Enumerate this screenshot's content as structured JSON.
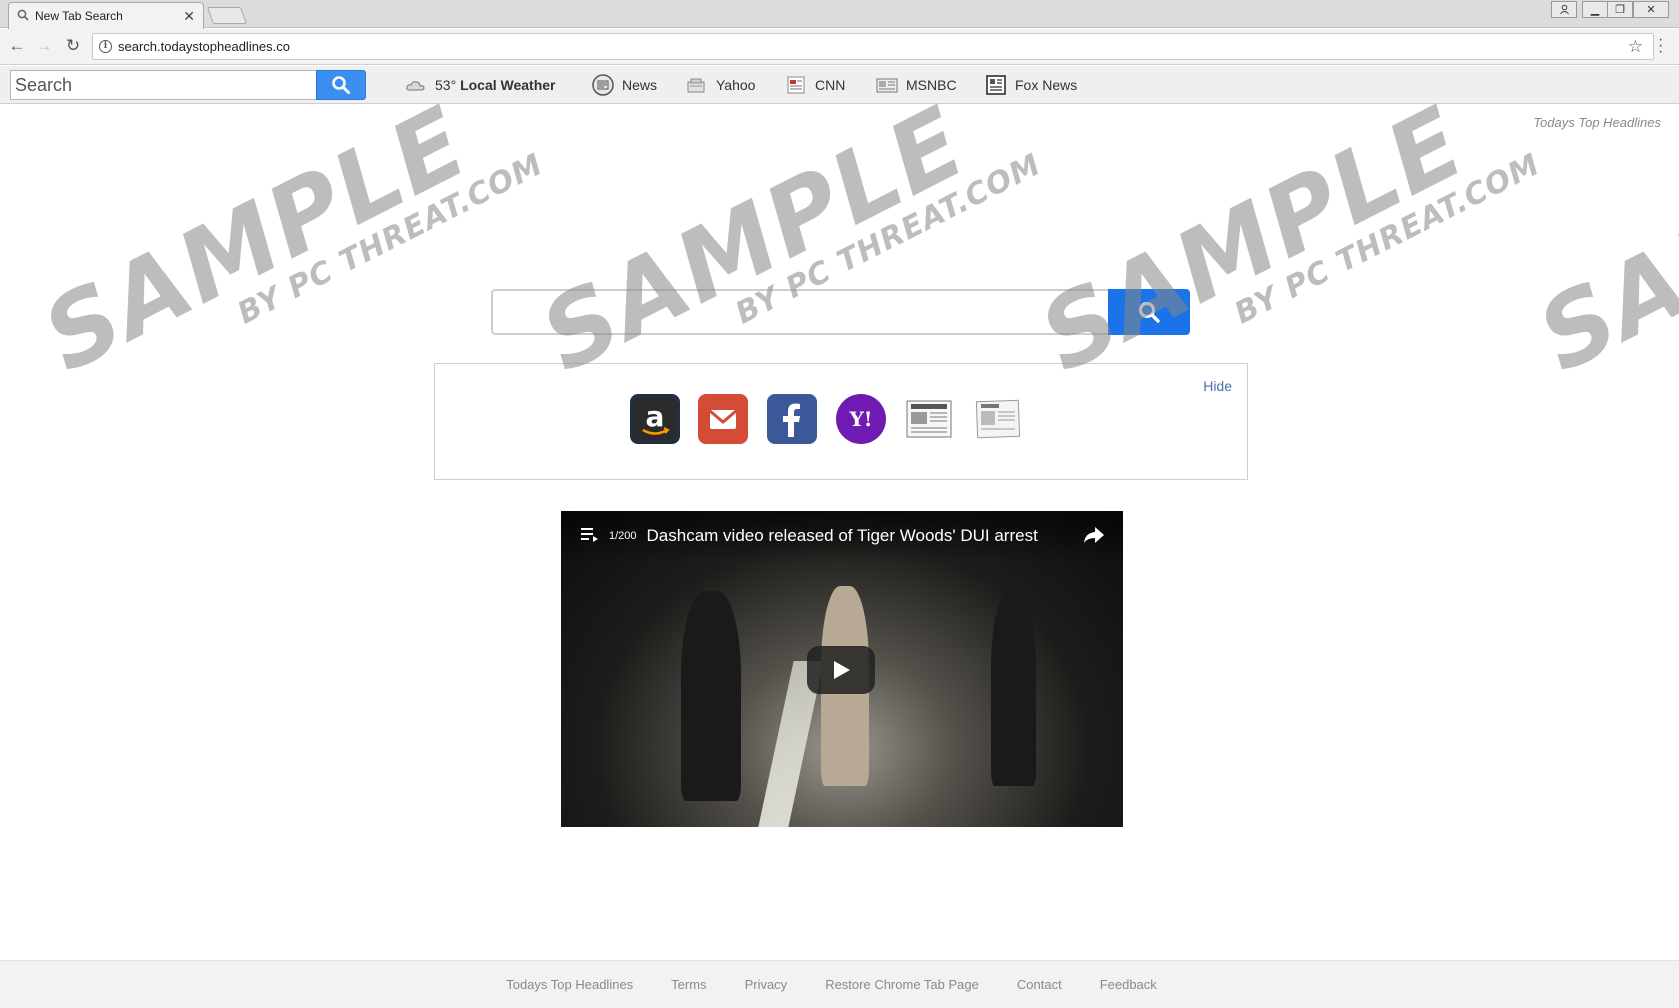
{
  "browser": {
    "tab_title": "New Tab Search",
    "url": "search.todaystopheadlines.co"
  },
  "extension_bar": {
    "search_placeholder": "Search",
    "weather_temp": "53°",
    "weather_label": "Local Weather",
    "links": [
      {
        "label": "News",
        "icon": "news-icon"
      },
      {
        "label": "Yahoo",
        "icon": "yahoo-icon"
      },
      {
        "label": "CNN",
        "icon": "cnn-icon"
      },
      {
        "label": "MSNBC",
        "icon": "msnbc-icon"
      },
      {
        "label": "Fox News",
        "icon": "fox-news-icon"
      }
    ]
  },
  "page": {
    "brand": "Todays Top Headlines",
    "hide_label": "Hide",
    "shortcuts": [
      {
        "name": "amazon-icon",
        "color": "#232f3e"
      },
      {
        "name": "gmail-icon",
        "color": "#d44c35"
      },
      {
        "name": "facebook-icon",
        "color": "#3b5998"
      },
      {
        "name": "yahoo-icon",
        "color": "#6f1bb2"
      },
      {
        "name": "newspaper-icon",
        "color": "#e8e8e8"
      },
      {
        "name": "daily-news-icon",
        "color": "#e8e8e8"
      }
    ]
  },
  "video": {
    "count": "1/200",
    "title": "Dashcam video released of Tiger Woods' DUI arrest"
  },
  "watermark": {
    "big": "SAMPLE",
    "small": "BY PC THREAT.COM"
  },
  "footer": {
    "links": [
      "Todays Top Headlines",
      "Terms",
      "Privacy",
      "Restore Chrome Tab Page",
      "Contact",
      "Feedback"
    ]
  },
  "colors": {
    "search_button": "#1a73e8",
    "link": "#4a6ea8"
  }
}
